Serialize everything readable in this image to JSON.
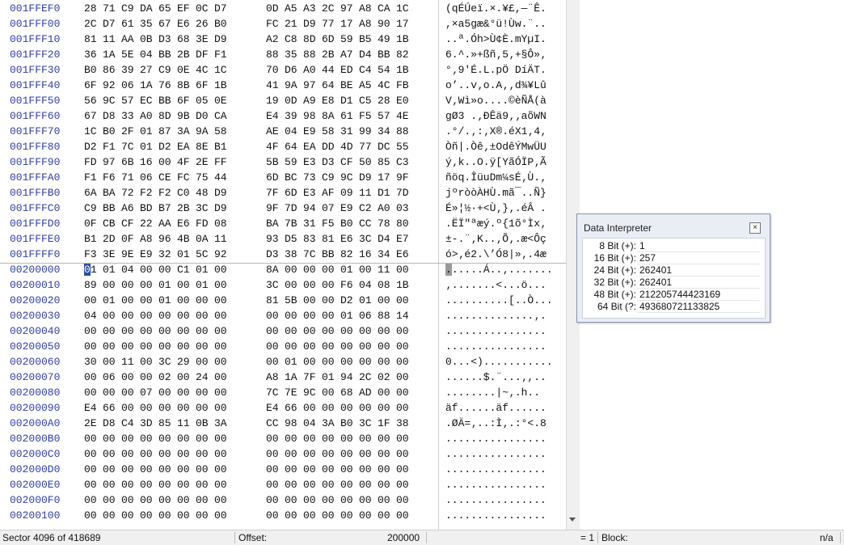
{
  "hex_rows": [
    {
      "addr": "001FFEF0",
      "bytes": [
        "28",
        "71",
        "C9",
        "DA",
        "65",
        "EF",
        "0C",
        "D7",
        "0D",
        "A5",
        "A3",
        "2C",
        "97",
        "A8",
        "CA",
        "1C"
      ],
      "ascii": "(qÉÚeï.×.¥£,—¨Ê."
    },
    {
      "addr": "001FFF00",
      "bytes": [
        "2C",
        "D7",
        "61",
        "35",
        "67",
        "E6",
        "26",
        "B0",
        "FC",
        "21",
        "D9",
        "77",
        "17",
        "A8",
        "90",
        "17"
      ],
      "ascii": ",×a5gæ&°ü!Ùw.¨.."
    },
    {
      "addr": "001FFF10",
      "bytes": [
        "81",
        "11",
        "AA",
        "0B",
        "D3",
        "68",
        "3E",
        "D9",
        "A2",
        "C8",
        "8D",
        "6D",
        "59",
        "B5",
        "49",
        "1B"
      ],
      "ascii": "..ª.Óh>Ù¢È.mYµI."
    },
    {
      "addr": "001FFF20",
      "bytes": [
        "36",
        "1A",
        "5E",
        "04",
        "BB",
        "2B",
        "DF",
        "F1",
        "88",
        "35",
        "88",
        "2B",
        "A7",
        "D4",
        "BB",
        "82"
      ],
      "ascii": "6.^.»+ßñ‚5‚+§Ô»‚"
    },
    {
      "addr": "001FFF30",
      "bytes": [
        "B0",
        "86",
        "39",
        "27",
        "C9",
        "0E",
        "4C",
        "1C",
        "70",
        "D6",
        "A0",
        "44",
        "ED",
        "C4",
        "54",
        "1B"
      ],
      "ascii": "°‚9'É.L.pÖ DíÄT."
    },
    {
      "addr": "001FFF40",
      "bytes": [
        "6F",
        "92",
        "06",
        "1A",
        "76",
        "8B",
        "6F",
        "1B",
        "41",
        "9A",
        "97",
        "64",
        "BE",
        "A5",
        "4C",
        "FB"
      ],
      "ascii": "o’..v‚o.A‚‚d¾¥Lû"
    },
    {
      "addr": "001FFF50",
      "bytes": [
        "56",
        "9C",
        "57",
        "EC",
        "BB",
        "6F",
        "05",
        "0E",
        "19",
        "0D",
        "A9",
        "E8",
        "D1",
        "C5",
        "28",
        "E0"
      ],
      "ascii": "V‚Wì»o....©èÑÅ(à"
    },
    {
      "addr": "001FFF60",
      "bytes": [
        "67",
        "D8",
        "33",
        "A0",
        "8D",
        "9B",
        "D0",
        "CA",
        "E4",
        "39",
        "98",
        "8A",
        "61",
        "F5",
        "57",
        "4E"
      ],
      "ascii": "gØ3 .‚ÐÊä9‚‚aõWN"
    },
    {
      "addr": "001FFF70",
      "bytes": [
        "1C",
        "B0",
        "2F",
        "01",
        "87",
        "3A",
        "9A",
        "58",
        "AE",
        "04",
        "E9",
        "58",
        "31",
        "99",
        "34",
        "88"
      ],
      "ascii": ".°/.‚:‚X®.éX1‚4‚"
    },
    {
      "addr": "001FFF80",
      "bytes": [
        "D2",
        "F1",
        "7C",
        "01",
        "D2",
        "EA",
        "8E",
        "B1",
        "4F",
        "64",
        "EA",
        "DD",
        "4D",
        "77",
        "DC",
        "55"
      ],
      "ascii": "Òñ|.Òê‚±OdêÝMwÜU"
    },
    {
      "addr": "001FFF90",
      "bytes": [
        "FD",
        "97",
        "6B",
        "16",
        "00",
        "4F",
        "2E",
        "FF",
        "5B",
        "59",
        "E3",
        "D3",
        "CF",
        "50",
        "85",
        "C3"
      ],
      "ascii": "ý‚k..O.ÿ[YãÓÏP‚Ã"
    },
    {
      "addr": "001FFFA0",
      "bytes": [
        "F1",
        "F6",
        "71",
        "06",
        "CE",
        "FC",
        "75",
        "44",
        "6D",
        "BC",
        "73",
        "C9",
        "9C",
        "D9",
        "17",
        "9F"
      ],
      "ascii": "ñöq.ÎüuDm¼sÉ‚Ù.‚"
    },
    {
      "addr": "001FFFB0",
      "bytes": [
        "6A",
        "BA",
        "72",
        "F2",
        "F2",
        "C0",
        "48",
        "D9",
        "7F",
        "6D",
        "E3",
        "AF",
        "09",
        "11",
        "D1",
        "7D"
      ],
      "ascii": "jºròòÀHÙ.mã¯..Ñ}"
    },
    {
      "addr": "001FFFC0",
      "bytes": [
        "C9",
        "BB",
        "A6",
        "BD",
        "B7",
        "2B",
        "3C",
        "D9",
        "9F",
        "7D",
        "94",
        "07",
        "E9",
        "C2",
        "A0",
        "03"
      ],
      "ascii": "É»¦½·+<Ù‚}‚.éÂ ."
    },
    {
      "addr": "001FFFD0",
      "bytes": [
        "0F",
        "CB",
        "CF",
        "22",
        "AA",
        "E6",
        "FD",
        "08",
        "BA",
        "7B",
        "31",
        "F5",
        "B0",
        "CC",
        "78",
        "80"
      ],
      "ascii": ".ËÏ\"ªæý.º{1õ°Ìx‚"
    },
    {
      "addr": "001FFFE0",
      "bytes": [
        "B1",
        "2D",
        "0F",
        "A8",
        "96",
        "4B",
        "0A",
        "11",
        "93",
        "D5",
        "83",
        "81",
        "E6",
        "3C",
        "D4",
        "E7"
      ],
      "ascii": "±-.¨‚K..‚Õ‚.æ<Ôç"
    },
    {
      "addr": "001FFFF0",
      "bytes": [
        "F3",
        "3E",
        "9E",
        "E9",
        "32",
        "01",
        "5C",
        "92",
        "D3",
        "38",
        "7C",
        "BB",
        "82",
        "16",
        "34",
        "E6"
      ],
      "ascii": "ó>‚é2.\\’Ó8|»‚.4æ"
    },
    {
      "addr": "00200000",
      "bytes": [
        "01",
        "01",
        "04",
        "00",
        "00",
        "C1",
        "01",
        "00",
        "8A",
        "00",
        "00",
        "00",
        "01",
        "00",
        "11",
        "00"
      ],
      "ascii": "......Á..‚......."
    },
    {
      "addr": "00200010",
      "bytes": [
        "89",
        "00",
        "00",
        "00",
        "01",
        "00",
        "01",
        "00",
        "3C",
        "00",
        "00",
        "00",
        "F6",
        "04",
        "08",
        "1B"
      ],
      "ascii": "‚.......<...ö..."
    },
    {
      "addr": "00200020",
      "bytes": [
        "00",
        "01",
        "00",
        "00",
        "01",
        "00",
        "00",
        "00",
        "81",
        "5B",
        "00",
        "00",
        "D2",
        "01",
        "00",
        "00"
      ],
      "ascii": "..........[..Ò..."
    },
    {
      "addr": "00200030",
      "bytes": [
        "04",
        "00",
        "00",
        "00",
        "00",
        "00",
        "00",
        "00",
        "00",
        "00",
        "00",
        "00",
        "01",
        "06",
        "88",
        "14"
      ],
      "ascii": "..............‚."
    },
    {
      "addr": "00200040",
      "bytes": [
        "00",
        "00",
        "00",
        "00",
        "00",
        "00",
        "00",
        "00",
        "00",
        "00",
        "00",
        "00",
        "00",
        "00",
        "00",
        "00"
      ],
      "ascii": "................"
    },
    {
      "addr": "00200050",
      "bytes": [
        "00",
        "00",
        "00",
        "00",
        "00",
        "00",
        "00",
        "00",
        "00",
        "00",
        "00",
        "00",
        "00",
        "00",
        "00",
        "00"
      ],
      "ascii": "................"
    },
    {
      "addr": "00200060",
      "bytes": [
        "30",
        "00",
        "11",
        "00",
        "3C",
        "29",
        "00",
        "00",
        "00",
        "01",
        "00",
        "00",
        "00",
        "00",
        "00",
        "00"
      ],
      "ascii": "0...<)..........."
    },
    {
      "addr": "00200070",
      "bytes": [
        "00",
        "06",
        "00",
        "00",
        "02",
        "00",
        "24",
        "00",
        "A8",
        "1A",
        "7F",
        "01",
        "94",
        "2C",
        "02",
        "00"
      ],
      "ascii": "......$.¨...‚,.."
    },
    {
      "addr": "00200080",
      "bytes": [
        "00",
        "00",
        "00",
        "07",
        "00",
        "00",
        "00",
        "00",
        "7C",
        "7E",
        "9C",
        "00",
        "68",
        "AD",
        "00",
        "00"
      ],
      "ascii": "........|~‚.h­.."
    },
    {
      "addr": "00200090",
      "bytes": [
        "E4",
        "66",
        "00",
        "00",
        "00",
        "00",
        "00",
        "00",
        "E4",
        "66",
        "00",
        "00",
        "00",
        "00",
        "00",
        "00"
      ],
      "ascii": "äf......äf......"
    },
    {
      "addr": "002000A0",
      "bytes": [
        "2E",
        "D8",
        "C4",
        "3D",
        "85",
        "11",
        "0B",
        "3A",
        "CC",
        "98",
        "04",
        "3A",
        "B0",
        "3C",
        "1F",
        "38"
      ],
      "ascii": ".ØÄ=‚..:Ì‚.:°<.8"
    },
    {
      "addr": "002000B0",
      "bytes": [
        "00",
        "00",
        "00",
        "00",
        "00",
        "00",
        "00",
        "00",
        "00",
        "00",
        "00",
        "00",
        "00",
        "00",
        "00",
        "00"
      ],
      "ascii": "................"
    },
    {
      "addr": "002000C0",
      "bytes": [
        "00",
        "00",
        "00",
        "00",
        "00",
        "00",
        "00",
        "00",
        "00",
        "00",
        "00",
        "00",
        "00",
        "00",
        "00",
        "00"
      ],
      "ascii": "................"
    },
    {
      "addr": "002000D0",
      "bytes": [
        "00",
        "00",
        "00",
        "00",
        "00",
        "00",
        "00",
        "00",
        "00",
        "00",
        "00",
        "00",
        "00",
        "00",
        "00",
        "00"
      ],
      "ascii": "................"
    },
    {
      "addr": "002000E0",
      "bytes": [
        "00",
        "00",
        "00",
        "00",
        "00",
        "00",
        "00",
        "00",
        "00",
        "00",
        "00",
        "00",
        "00",
        "00",
        "00",
        "00"
      ],
      "ascii": "................"
    },
    {
      "addr": "002000F0",
      "bytes": [
        "00",
        "00",
        "00",
        "00",
        "00",
        "00",
        "00",
        "00",
        "00",
        "00",
        "00",
        "00",
        "00",
        "00",
        "00",
        "00"
      ],
      "ascii": "................"
    },
    {
      "addr": "00200100",
      "bytes": [
        "00",
        "00",
        "00",
        "00",
        "00",
        "00",
        "00",
        "00",
        "00",
        "00",
        "00",
        "00",
        "00",
        "00",
        "00",
        "00"
      ],
      "ascii": "................"
    }
  ],
  "data_interpreter": {
    "title": "Data Interpreter",
    "close_icon": "close-icon",
    "rows": [
      {
        "label": "8 Bit (+):",
        "value": "1"
      },
      {
        "label": "16 Bit (+):",
        "value": "257"
      },
      {
        "label": "24 Bit (+):",
        "value": "262401"
      },
      {
        "label": "32 Bit (+):",
        "value": "262401"
      },
      {
        "label": "48 Bit (+):",
        "value": "212205744423169"
      },
      {
        "label": "64 Bit (?:",
        "value": "493680721133825"
      }
    ]
  },
  "status_bar": {
    "sector": "Sector 4096 of 418689",
    "offset_label": "Offset:",
    "offset_value": "200000",
    "equals": "= 1",
    "block_label": "Block:",
    "block_value": "n/a"
  },
  "colors": {
    "address": "#2f3fa6",
    "cursor": "#2b4fb0"
  }
}
